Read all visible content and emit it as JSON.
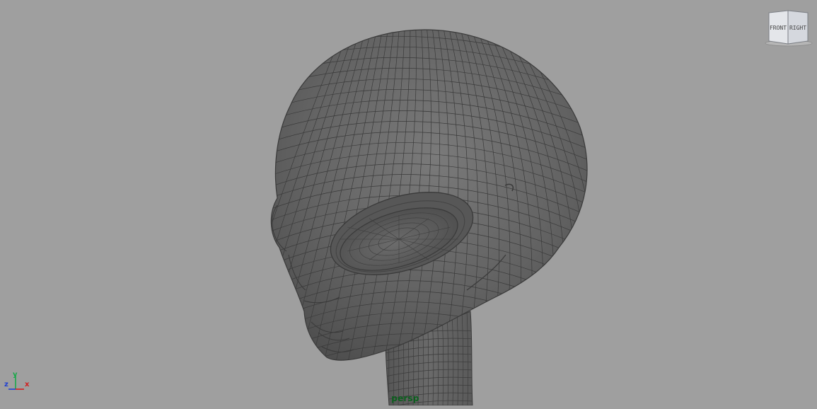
{
  "viewport": {
    "background": "#9f9f9f",
    "camera_label": "persp"
  },
  "model": {
    "name": "alien-head",
    "shading": "wireframe-on-shaded",
    "surface_color": "#5f5f5f",
    "wire_color": "#3a3a3a"
  },
  "view_cube": {
    "front_label": "FRONT",
    "right_label": "RIGHT"
  },
  "axis_indicator": {
    "x_label": "x",
    "y_label": "y",
    "z_label": "z",
    "x_color": "#d21f1f",
    "y_color": "#1aa84a",
    "z_color": "#1f3fd2"
  }
}
